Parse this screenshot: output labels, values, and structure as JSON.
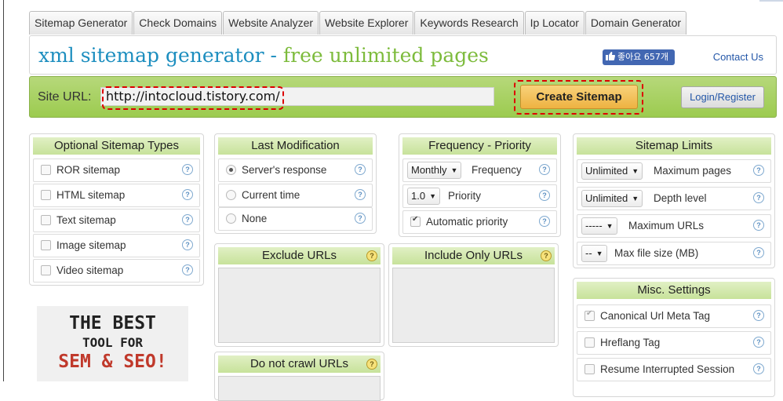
{
  "tabs": [
    "Sitemap Generator",
    "Check Domains",
    "Website Analyzer",
    "Website Explorer",
    "Keywords Research",
    "Ip Locator",
    "Domain Generator"
  ],
  "header": {
    "title_main": "xml sitemap generator",
    "title_sep": " - ",
    "title_sub": "free unlimited pages",
    "like_label": "좋아요 657개",
    "contact": "Contact Us"
  },
  "urlbar": {
    "label": "Site URL:",
    "value": "http://intocloud.tistory.com/",
    "create_button": "Create Sitemap",
    "login_button": "Login/Register"
  },
  "sitemap_types": {
    "title": "Optional Sitemap Types",
    "items": [
      {
        "label": "ROR sitemap",
        "checked": false
      },
      {
        "label": "HTML sitemap",
        "checked": false
      },
      {
        "label": "Text sitemap",
        "checked": false
      },
      {
        "label": "Image sitemap",
        "checked": false
      },
      {
        "label": "Video sitemap",
        "checked": false
      }
    ]
  },
  "last_modification": {
    "title": "Last Modification",
    "options": [
      {
        "label": "Server's response",
        "selected": true
      },
      {
        "label": "Current time",
        "selected": false
      },
      {
        "label": "None",
        "selected": false
      }
    ]
  },
  "frequency_priority": {
    "title": "Frequency - Priority",
    "frequency_value": "Monthly",
    "frequency_label": "Frequency",
    "priority_value": "1.0",
    "priority_label": "Priority",
    "auto_priority_label": "Automatic priority",
    "auto_priority_checked": true
  },
  "sitemap_limits": {
    "title": "Sitemap Limits",
    "rows": [
      {
        "value": "Unlimited",
        "label": "Maximum pages"
      },
      {
        "value": "Unlimited",
        "label": "Depth level"
      },
      {
        "value": "-----",
        "label": "Maximum URLs"
      },
      {
        "value": "--",
        "label": "Max file size (MB)"
      }
    ]
  },
  "exclude_urls": {
    "title": "Exclude URLs"
  },
  "include_only_urls": {
    "title": "Include Only URLs"
  },
  "do_not_crawl": {
    "title": "Do not crawl URLs"
  },
  "misc_settings": {
    "title": "Misc. Settings",
    "items": [
      {
        "label": "Canonical Url Meta Tag",
        "checked": true
      },
      {
        "label": "Hreflang Tag",
        "checked": false
      },
      {
        "label": "Resume Interrupted Session",
        "checked": false
      }
    ]
  },
  "ad": {
    "line1": "THE BEST",
    "line2": "TOOL FOR",
    "line3": "SEM & SEO!"
  },
  "colors": {
    "accent_blue": "#1d8ebf",
    "accent_green": "#7dbb3c",
    "bar_green": "#a8d263",
    "create_orange": "#f0b444",
    "highlight_red": "#dd0000"
  },
  "icons": {
    "help": "question-circle-icon",
    "like": "thumbs-up-icon",
    "dropdown": "caret-down-icon"
  }
}
